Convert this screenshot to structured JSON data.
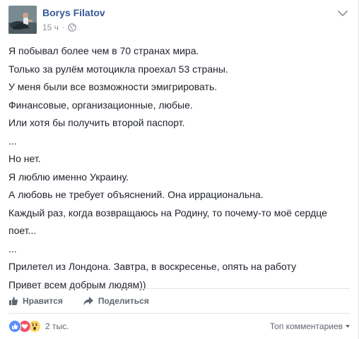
{
  "post": {
    "author": "Borys Filatov",
    "timestamp": "15 ч",
    "separator": "·",
    "privacy_icon": "globe-icon",
    "menu_icon": "chevron-down-icon",
    "lines": [
      "Я побывал более чем в 70 странах мира.",
      "Только за рулём мотоцикла проехал 53 страны.",
      "У меня были все возможности эмигрировать.",
      "Финансовые, организационные, любые.",
      "Или хотя бы получить второй паспорт.",
      "...",
      "Но нет.",
      "Я люблю именно Украину.",
      "А любовь не требует объяснений. Она иррациональна.",
      "Каждый раз, когда возвращаюсь на Родину, то почему-то моё сердце поет...",
      "...",
      "Прилетел из Лондона. Завтра, в воскресенье, опять на работу",
      "Привет всем добрым людям))"
    ]
  },
  "actions": {
    "like_label": "Нравится",
    "like_icon": "thumbs-up-icon",
    "share_label": "Поделиться",
    "share_icon": "share-arrow-icon"
  },
  "footer": {
    "reaction_icons": [
      "like-reaction-icon",
      "love-reaction-icon",
      "wow-reaction-icon"
    ],
    "reaction_count": "2 тыс.",
    "sort_label": "Топ комментариев"
  },
  "colors": {
    "link": "#365899",
    "text": "#1d2129",
    "muted": "#90949c",
    "action_text": "#606770",
    "like_blue": "#5890ff",
    "love_red": "#f25268",
    "wow_yellow": "#fcd669"
  }
}
